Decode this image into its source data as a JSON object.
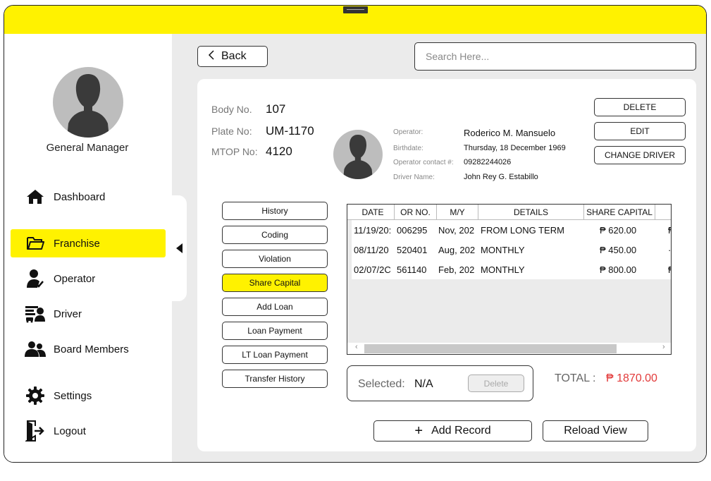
{
  "sidebar": {
    "role": "General Manager",
    "items": [
      {
        "label": "Dashboard"
      },
      {
        "label": "Franchise"
      },
      {
        "label": "Operator"
      },
      {
        "label": "Driver"
      },
      {
        "label": "Board Members"
      },
      {
        "label": "Settings"
      },
      {
        "label": "Logout"
      }
    ]
  },
  "header": {
    "back_label": "Back",
    "search_placeholder": "Search Here..."
  },
  "vehicle": {
    "body_label": "Body No.",
    "body_value": "107",
    "plate_label": "Plate No:",
    "plate_value": "UM-1170",
    "mtop_label": "MTOP No:",
    "mtop_value": "4120"
  },
  "operator": {
    "operator_label": "Operator:",
    "operator_value": "Roderico M. Mansuelo",
    "birthdate_label": "Birthdate:",
    "birthdate_value": "Thursday, 18 December 1969",
    "contact_label": "Operator contact #:",
    "contact_value": "09282244026",
    "driver_label": "Driver Name:",
    "driver_value": "John Rey G. Estabillo"
  },
  "actions": {
    "delete": "DELETE",
    "edit": "EDIT",
    "change_driver": "CHANGE DRIVER"
  },
  "side_tabs": [
    {
      "label": "History"
    },
    {
      "label": "Coding"
    },
    {
      "label": "Violation"
    },
    {
      "label": "Share Capital"
    },
    {
      "label": "Add Loan"
    },
    {
      "label": "Loan Payment"
    },
    {
      "label": "LT Loan Payment"
    },
    {
      "label": "Transfer History"
    }
  ],
  "table": {
    "columns": [
      "DATE",
      "OR NO.",
      "M/Y",
      "DETAILS",
      "SHARE CAPITAL"
    ],
    "rows": [
      {
        "date": "11/19/20:",
        "or_no": "006295",
        "my": "Nov, 202",
        "details": "FROM LONG TERM",
        "share": "₱ 620.00",
        "extra": "₱"
      },
      {
        "date": "08/11/20",
        "or_no": "520401",
        "my": "Aug, 202",
        "details": "MONTHLY",
        "share": "₱ 450.00",
        "extra": "·"
      },
      {
        "date": "02/07/2C",
        "or_no": "561140",
        "my": "Feb, 202",
        "details": "MONTHLY",
        "share": "₱ 800.00",
        "extra": "₱"
      }
    ],
    "scroll_left": "‹",
    "scroll_right": "›"
  },
  "selection": {
    "label": "Selected:",
    "value": "N/A",
    "delete_label": "Delete"
  },
  "total": {
    "label": "TOTAL :",
    "value": "₱ 1870.00"
  },
  "footer": {
    "add_record": "Add Record",
    "add_icon": "+",
    "reload": "Reload View"
  },
  "colors": {
    "accent": "#fff200",
    "total": "#e23a3a"
  }
}
